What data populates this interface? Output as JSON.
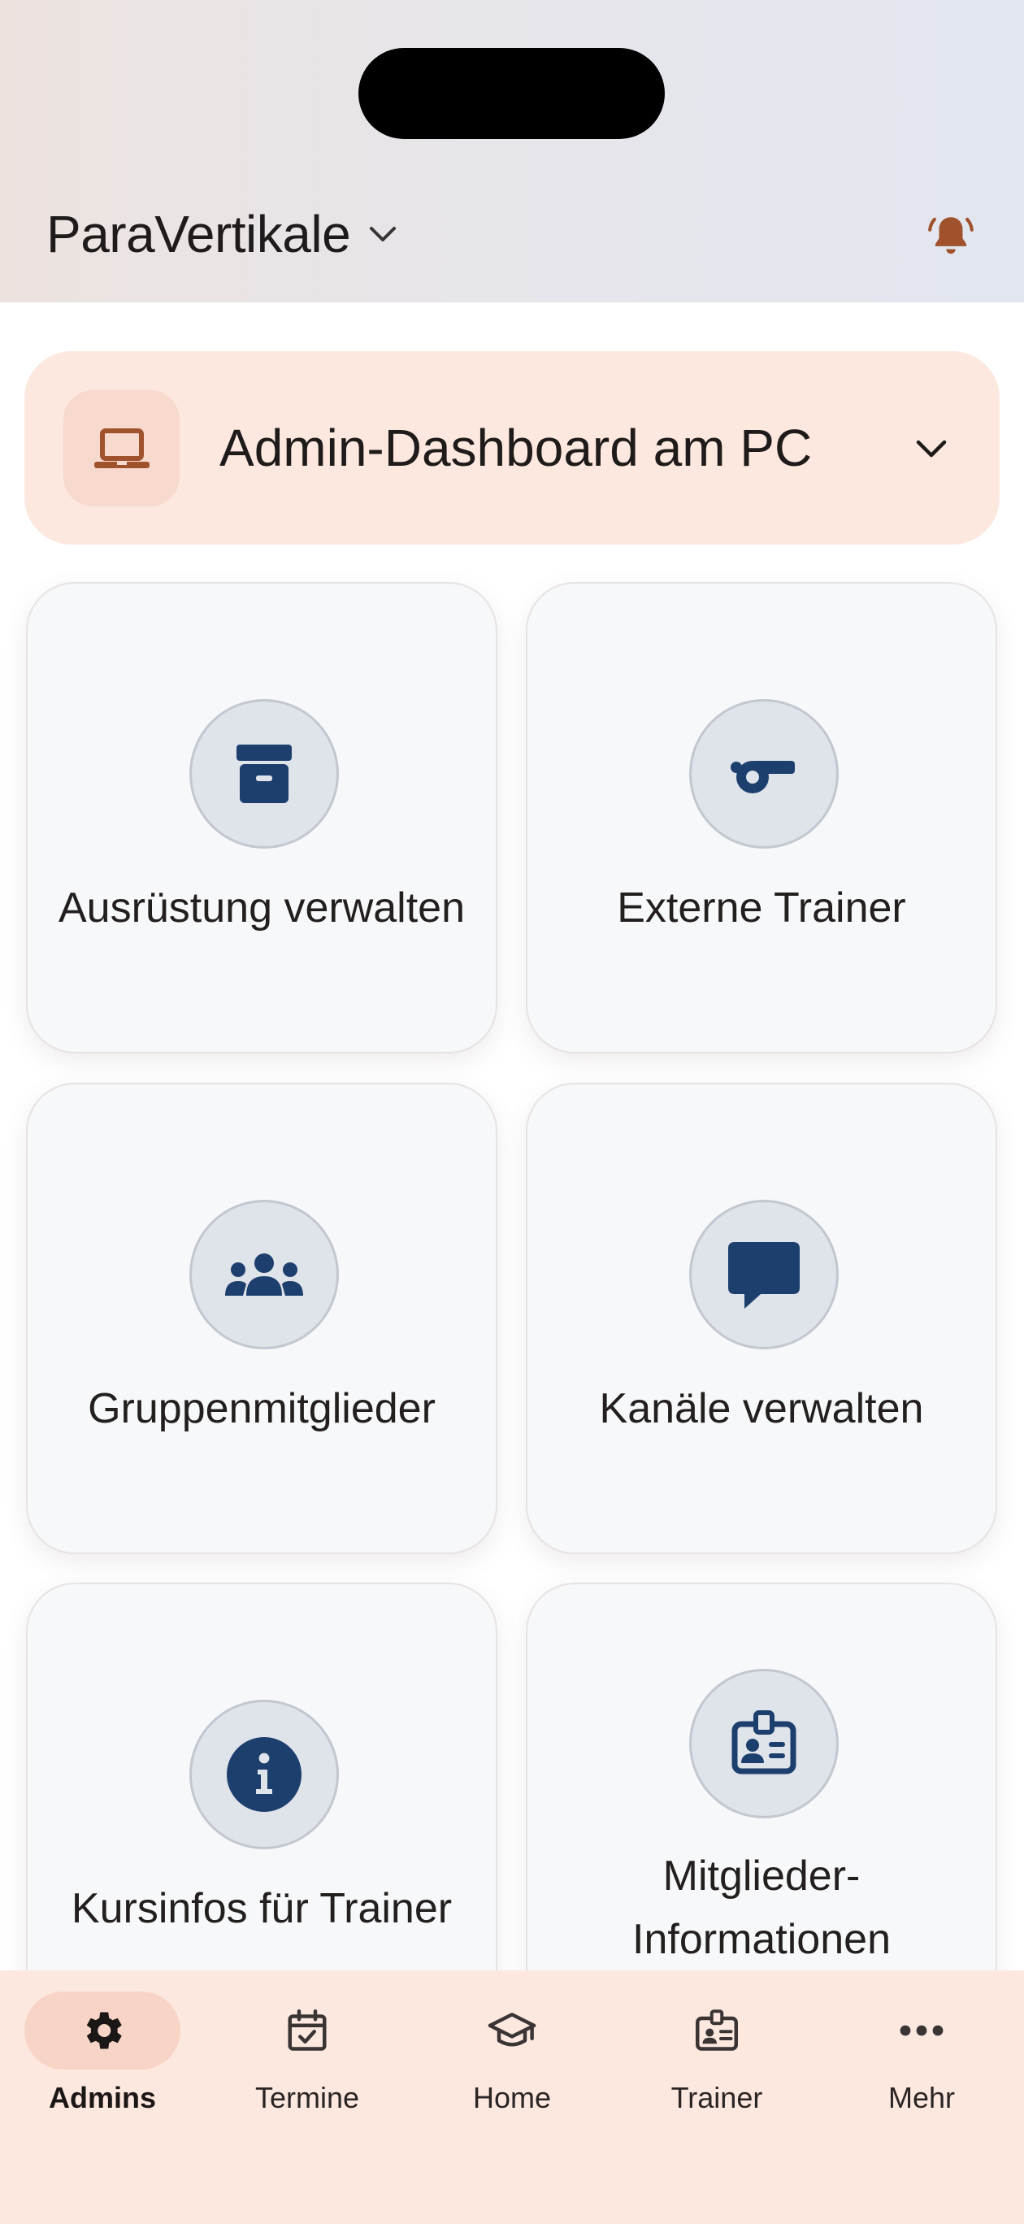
{
  "header": {
    "app_title": "ParaVertikale",
    "switch_icon": "chevron-down-icon",
    "notification_icon": "bell-icon"
  },
  "banner": {
    "text": "Admin-Dashboard am PC",
    "icon": "laptop-icon",
    "toggle_icon": "chevron-down-icon"
  },
  "cards": [
    {
      "label": "Ausrüstung verwalten",
      "icon": "archive-box-icon"
    },
    {
      "label": "Externe Trainer",
      "icon": "whistle-icon"
    },
    {
      "label": "Gruppenmitglieder",
      "icon": "group-icon"
    },
    {
      "label": "Kanäle verwalten",
      "icon": "chat-bubble-icon"
    },
    {
      "label": "Kursinfos für Trainer",
      "icon": "info-icon"
    },
    {
      "label": "Mitglieder-Informationen",
      "icon": "id-badge-icon"
    }
  ],
  "bottom_nav": {
    "items": [
      {
        "label": "Admins",
        "icon": "gear-icon",
        "active": true
      },
      {
        "label": "Termine",
        "icon": "calendar-check-icon",
        "active": false
      },
      {
        "label": "Home",
        "icon": "graduation-cap-icon",
        "active": false
      },
      {
        "label": "Trainer",
        "icon": "id-badge-icon",
        "active": false
      },
      {
        "label": "Mehr",
        "icon": "more-dots-icon",
        "active": false
      }
    ]
  },
  "colors": {
    "accent": "#a0522d",
    "icon_navy": "#1d3f6e",
    "banner_bg": "#fde8e0",
    "nav_active": "#f8d4c6"
  }
}
